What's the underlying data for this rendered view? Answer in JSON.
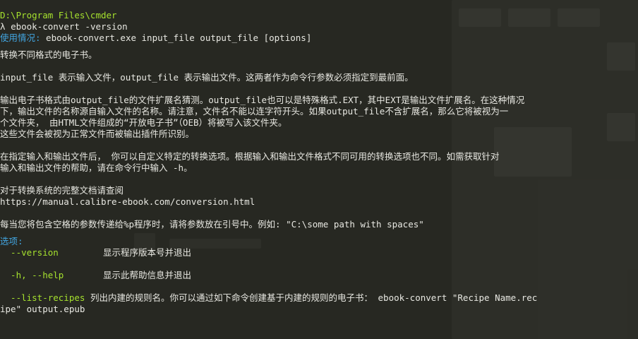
{
  "window": {
    "cwd": "D:\\Program Files\\cmder",
    "prompt_symbol": "λ",
    "command": "ebook-convert -version"
  },
  "usage": {
    "label": "使用情况:",
    "text": " ebook-convert.exe input_file output_file [options]"
  },
  "description": {
    "summary": "转换不同格式的电子书。",
    "para1": "input_file 表示输入文件，output_file 表示输出文件。这两者作为命令行参数必须指定到最前面。",
    "para2_line1": "输出电子书格式由output_file的文件扩展名猜测。output_file也可以是特殊格式.EXT，其中EXT是输出文件扩展名。在这种情况",
    "para2_line2": "下，输出文件的名称源自输入文件的名称。请注意，文件名不能以连字符开头。如果output_file不含扩展名，那么它将被视为一",
    "para2_line3": "个文件夹， 由HTML文件组成的“开放电子书”（OEB）将被写入该文件夹。",
    "para2_line4": "这些文件会被视为正常文件而被输出插件所识别。",
    "para3_line1": "在指定输入和输出文件后， 你可以自定义特定的转换选项。根据输入和输出文件格式不同可用的转换选项也不同。如需获取针对",
    "para3_line2": "输入和输出文件的帮助，请在命令行中输入 -h。",
    "docs_label": "对于转换系统的完整文档请查阅",
    "docs_url": "https://manual.calibre-ebook.com/conversion.html",
    "quote_note": "每当您将包含空格的参数传递给%p程序时，请将参数放在引号中。例如: \"C:\\some path with spaces\""
  },
  "options": {
    "label": "选项:",
    "items": [
      {
        "name": "  --version",
        "desc": "显示程序版本号并退出"
      },
      {
        "name": "  -h, --help",
        "desc": "显示此帮助信息并退出"
      },
      {
        "name": "  --list-recipes",
        "desc": "列出内建的规则名。你可以通过如下命令创建基于内建的规则的电子书： ebook-convert \"Recipe Name.rec"
      }
    ],
    "wrap_line": "ipe\" output.epub"
  },
  "colors": {
    "background": "#272822",
    "path": "#a6e22e",
    "label": "#42a5e0",
    "text": "#e8e8e2"
  }
}
